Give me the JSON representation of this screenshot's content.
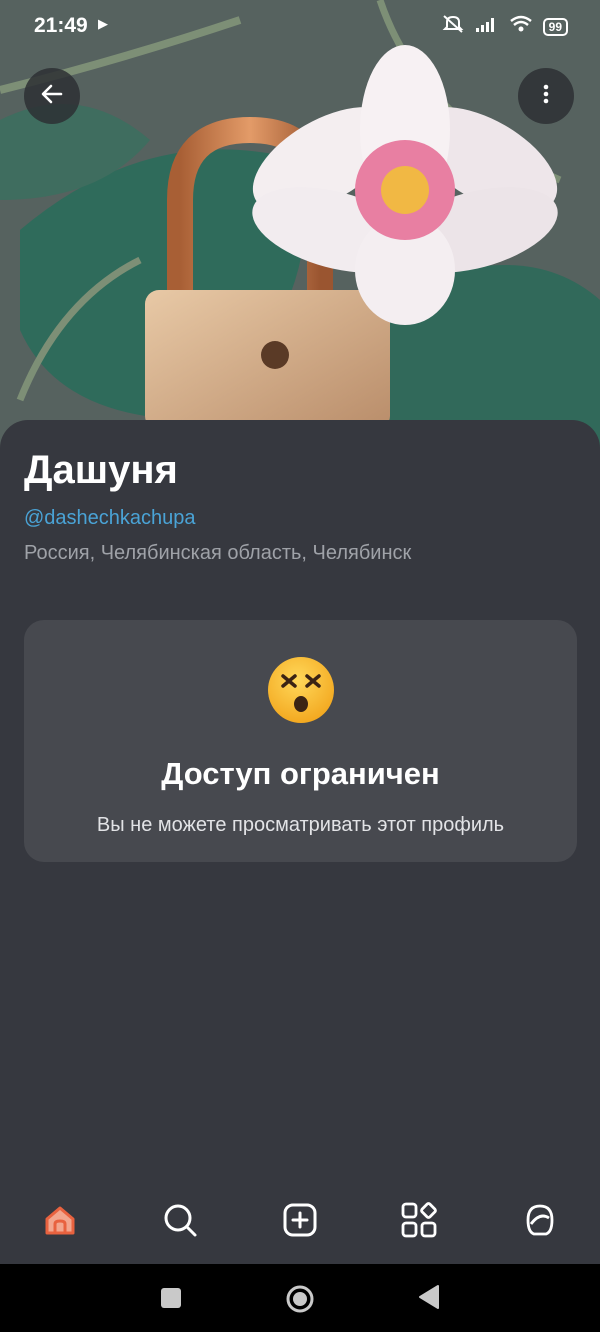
{
  "status_bar": {
    "time": "21:49",
    "battery": "99"
  },
  "profile": {
    "name": "Дашуня",
    "handle": "@dashechkachupa",
    "location": "Россия, Челябинская область, Челябинск"
  },
  "restricted": {
    "title": "Доступ ограничен",
    "message": "Вы не можете просматривать этот профиль"
  },
  "tabbar": {
    "items": [
      "home-icon",
      "search-icon",
      "add-icon",
      "apps-icon",
      "profile-icon"
    ],
    "active": "home-icon",
    "accent": "#f27b5a"
  },
  "colors": {
    "background": "#36383f",
    "card": "#47494f",
    "link": "#4aa3d6"
  }
}
